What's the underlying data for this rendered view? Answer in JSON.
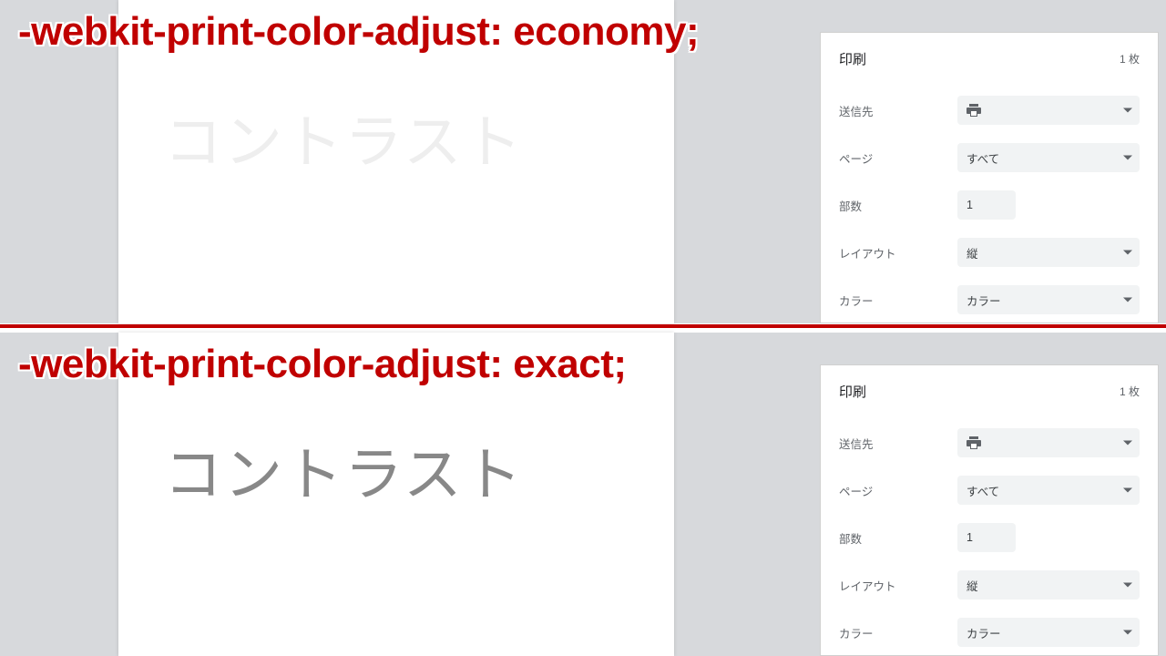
{
  "top": {
    "overlay": "-webkit-print-color-adjust: economy;",
    "preview_text": "コントラスト",
    "panel": {
      "title": "印刷",
      "sheets": "1 枚",
      "rows": {
        "destination_label": "送信先",
        "pages_label": "ページ",
        "pages_value": "すべて",
        "copies_label": "部数",
        "copies_value": "1",
        "layout_label": "レイアウト",
        "layout_value": "縦",
        "color_label": "カラー",
        "color_value": "カラー"
      }
    }
  },
  "bottom": {
    "overlay": "-webkit-print-color-adjust: exact;",
    "preview_text": "コントラスト",
    "panel": {
      "title": "印刷",
      "sheets": "1 枚",
      "rows": {
        "destination_label": "送信先",
        "pages_label": "ページ",
        "pages_value": "すべて",
        "copies_label": "部数",
        "copies_value": "1",
        "layout_label": "レイアウト",
        "layout_value": "縦",
        "color_label": "カラー",
        "color_value": "カラー"
      }
    }
  }
}
